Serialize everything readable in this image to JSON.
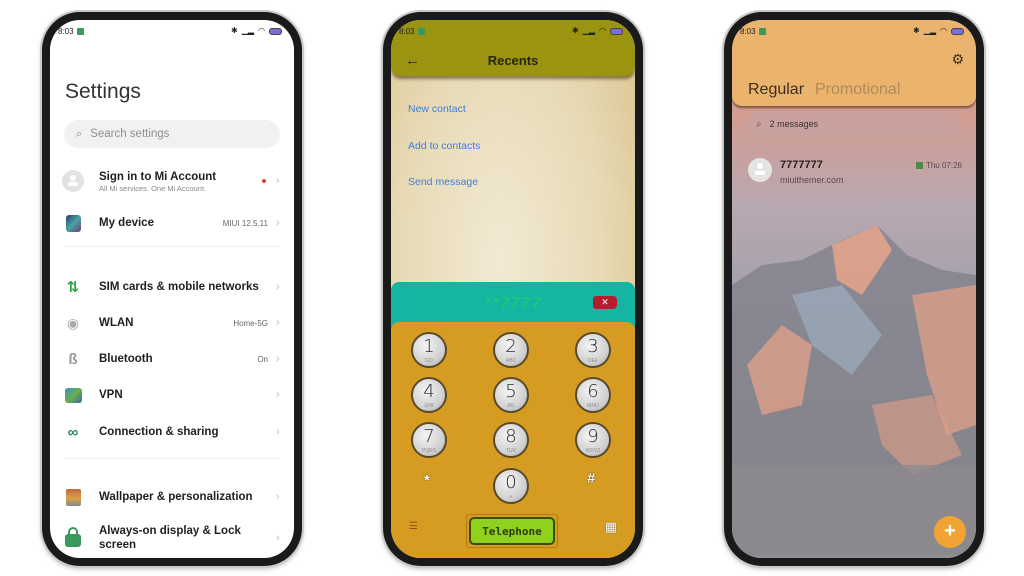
{
  "status_bar": {
    "time": "8:03",
    "icons": [
      "bluetooth-icon",
      "signal-icon",
      "wifi-icon",
      "battery-icon"
    ]
  },
  "settings": {
    "title": "Settings",
    "search_placeholder": "Search settings",
    "account": {
      "label": "Sign in to Mi Account",
      "sub": "All Mi services. One Mi Account."
    },
    "items": [
      {
        "label": "My device",
        "value": "MIUI 12.5.11",
        "icon": "device-icon"
      },
      {
        "label": "SIM cards & mobile networks",
        "value": "",
        "icon": "sim-icon"
      },
      {
        "label": "WLAN",
        "value": "Home-5G",
        "icon": "wifi-icon"
      },
      {
        "label": "Bluetooth",
        "value": "On",
        "icon": "bluetooth-icon"
      },
      {
        "label": "VPN",
        "value": "",
        "icon": "vpn-icon"
      },
      {
        "label": "Connection & sharing",
        "value": "",
        "icon": "link-icon"
      },
      {
        "label": "Wallpaper & personalization",
        "value": "",
        "icon": "wallpaper-icon"
      },
      {
        "label": "Always-on display & Lock screen",
        "value": "",
        "icon": "lock-icon"
      }
    ],
    "chevron": "›"
  },
  "dialer": {
    "back": "←",
    "title": "Recents",
    "links": [
      "New contact",
      "Add to contacts",
      "Send message"
    ],
    "number": "**7777",
    "delete_icon": "✕",
    "keys": [
      {
        "num": "1",
        "letters": "GO"
      },
      {
        "num": "2",
        "letters": "ABC"
      },
      {
        "num": "3",
        "letters": "DEF"
      },
      {
        "num": "4",
        "letters": "GHI"
      },
      {
        "num": "5",
        "letters": "JKL"
      },
      {
        "num": "6",
        "letters": "MNO"
      },
      {
        "num": "7",
        "letters": "PQRS"
      },
      {
        "num": "8",
        "letters": "TUV"
      },
      {
        "num": "9",
        "letters": "WXYZ"
      },
      {
        "num": "0",
        "letters": "+"
      }
    ],
    "star": "*",
    "hash": "#",
    "call_label": "Telephone",
    "menu_icon": "☰",
    "keypad_icon": "▦"
  },
  "messages": {
    "tabs": [
      "Regular",
      "Promotional"
    ],
    "search_text": "2 messages",
    "gear_icon": "⚙",
    "conversations": [
      {
        "name": "7777777",
        "preview": "miuithemer.com",
        "time": "Thu 07:26"
      }
    ],
    "fab_icon": "+"
  },
  "colors": {
    "dialer_header": "#9a9410",
    "dialer_display": "#16b4a2",
    "dialer_pad": "#d69c22",
    "call_button": "#8fd21e",
    "messages_header": "#eab46e",
    "fab": "#f1a434",
    "link": "#3d7fd6"
  }
}
